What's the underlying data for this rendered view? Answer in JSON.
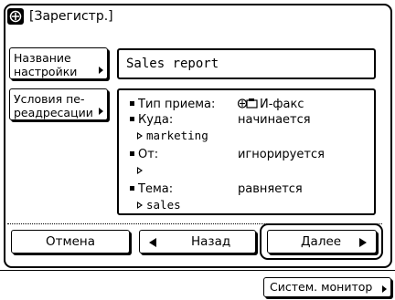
{
  "window": {
    "title": "[Зарегистр.]",
    "icon": "register-icon"
  },
  "settings_name": {
    "label_line1": "Название",
    "label_line2": "настройки",
    "value": "Sales report"
  },
  "conditions": {
    "label_line1": "Условия пе-",
    "label_line2": "реадресации",
    "items": [
      {
        "key": "Тип приема:",
        "value": "И-факс",
        "icon": "ifax-icon"
      },
      {
        "key": "Куда:",
        "value": "начинается",
        "sub": "marketing"
      },
      {
        "key": "От:",
        "value": "игнорируется",
        "sub": ""
      },
      {
        "key": "Тема:",
        "value": "равняется",
        "sub": "sales"
      }
    ]
  },
  "buttons": {
    "cancel": "Отмена",
    "back": "Назад",
    "next": "Далее",
    "system_monitor": "Систем. монитор"
  }
}
